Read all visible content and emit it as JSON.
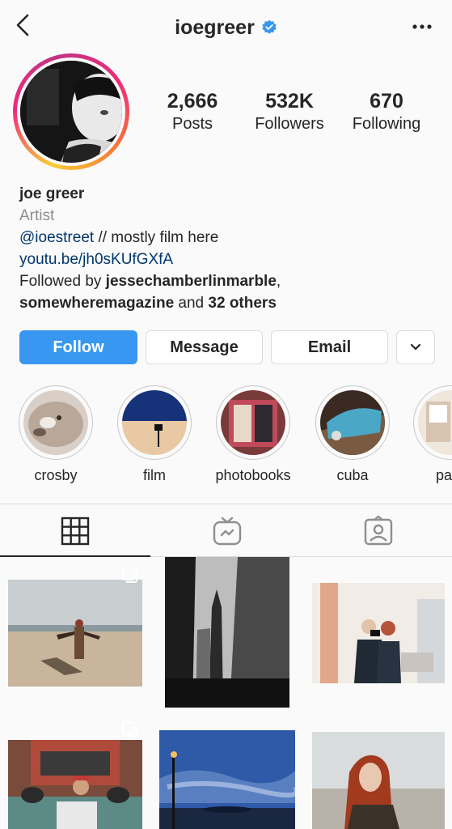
{
  "header": {
    "username": "ioegreer"
  },
  "profile": {
    "stats": [
      {
        "value": "2,666",
        "label": "Posts"
      },
      {
        "value": "532K",
        "label": "Followers"
      },
      {
        "value": "670",
        "label": "Following"
      }
    ],
    "name": "joe greer",
    "category": "Artist",
    "bio_mention": "@ioestreet",
    "bio_rest": " // mostly film here",
    "website": "youtu.be/jh0sKUfGXfA",
    "followed_by_prefix": "Followed by ",
    "followed_by_user1": "jessechamberlinmarble",
    "followed_by_comma": ",",
    "followed_by_user2": "somewheremagazine",
    "followed_by_and": " and ",
    "followed_by_others": "32 others"
  },
  "actions": {
    "follow": "Follow",
    "message": "Message",
    "email": "Email"
  },
  "highlights": [
    {
      "label": "crosby"
    },
    {
      "label": "film"
    },
    {
      "label": "photobooks"
    },
    {
      "label": "cuba"
    },
    {
      "label": "pa"
    }
  ],
  "colors": {
    "accent": "#3897f0",
    "link": "#00376b",
    "text": "#262626",
    "muted": "#8e8e8e",
    "border": "#dbdbdb"
  }
}
